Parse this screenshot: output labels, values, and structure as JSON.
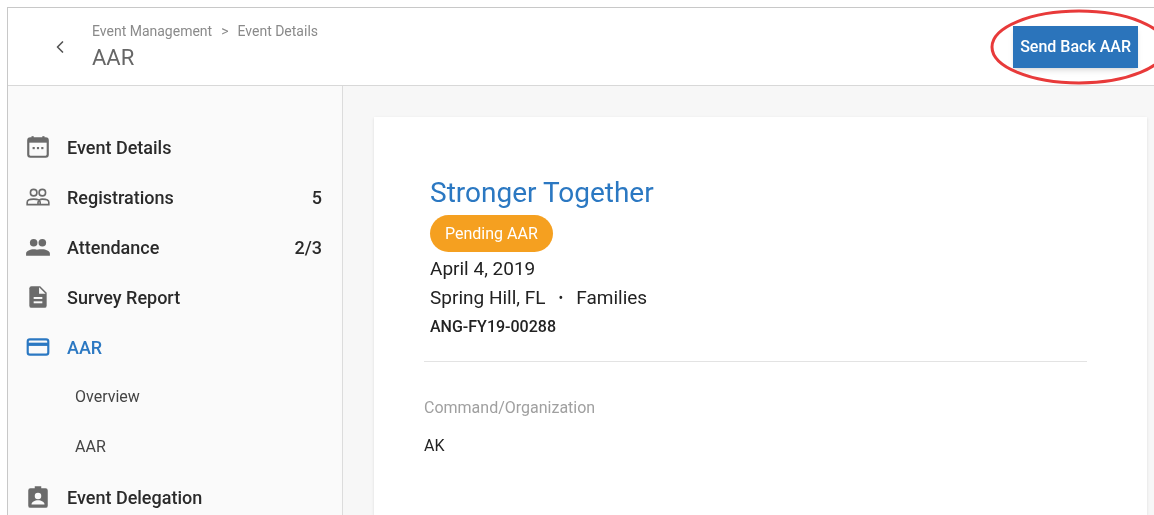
{
  "header": {
    "breadcrumb": [
      "Event Management",
      "Event Details"
    ],
    "breadcrumb_separator": ">",
    "title": "AAR",
    "action_button": {
      "label": "Send Back AAR",
      "highlighted": true
    }
  },
  "sidebar": {
    "items": [
      {
        "label": "Event Details",
        "selected": false
      },
      {
        "label": "Registrations",
        "count": "5",
        "selected": false
      },
      {
        "label": "Attendance",
        "count": "2/3",
        "selected": false
      },
      {
        "label": "Survey Report",
        "selected": false
      },
      {
        "label": "AAR",
        "selected": true,
        "children": [
          {
            "label": "Overview"
          },
          {
            "label": "AAR"
          }
        ]
      },
      {
        "label": "Event Delegation",
        "selected": false
      }
    ]
  },
  "event": {
    "title": "Stronger Together",
    "status": "Pending AAR",
    "date": "April 4, 2019",
    "location": "Spring Hill, FL",
    "separator": "•",
    "audience": "Families",
    "code": "ANG-FY19-00288",
    "fields": [
      {
        "label": "Command/Organization",
        "value": "AK"
      }
    ]
  }
}
